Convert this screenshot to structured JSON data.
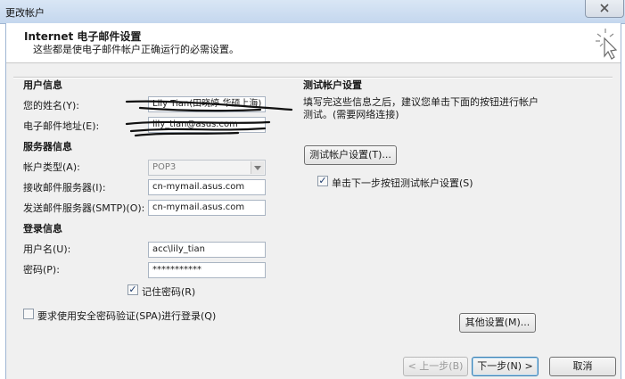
{
  "window": {
    "title": "更改帐户",
    "close_icon": "close-icon"
  },
  "header": {
    "title": "Internet 电子邮件设置",
    "subtitle": "这些都是使电子邮件帐户正确运行的必需设置。",
    "icon": "magic-wand-cursor-icon"
  },
  "user_info": {
    "section": "用户信息",
    "name_label": "您的姓名(Y):",
    "name_value": "Lily Tian(田晓婷 华硕上海)",
    "email_label": "电子邮件地址(E):",
    "email_value": "lily_tian@asus.com"
  },
  "server_info": {
    "section": "服务器信息",
    "account_type_label": "帐户类型(A):",
    "account_type_value": "POP3",
    "incoming_label": "接收邮件服务器(I):",
    "incoming_value": "cn-mymail.asus.com",
    "outgoing_label": "发送邮件服务器(SMTP)(O):",
    "outgoing_value": "cn-mymail.asus.com"
  },
  "login_info": {
    "section": "登录信息",
    "username_label": "用户名(U):",
    "username_value": "acc\\lily_tian",
    "password_label": "密码(P):",
    "password_value": "***********",
    "remember_label": "记住密码(R)",
    "remember_checked": true
  },
  "spa": {
    "label": "要求使用安全密码验证(SPA)进行登录(Q)",
    "checked": false
  },
  "test": {
    "section": "测试帐户设置",
    "description": "填写完这些信息之后，建议您单击下面的按钮进行帐户测试。(需要网络连接)",
    "button": "测试帐户设置(T)...",
    "auto_test_label": "单击下一步按钮测试帐户设置(S)",
    "auto_test_checked": true
  },
  "more_settings_button": "其他设置(M)...",
  "nav": {
    "back": "< 上一步(B)",
    "next": "下一步(N) >",
    "cancel": "取消"
  }
}
